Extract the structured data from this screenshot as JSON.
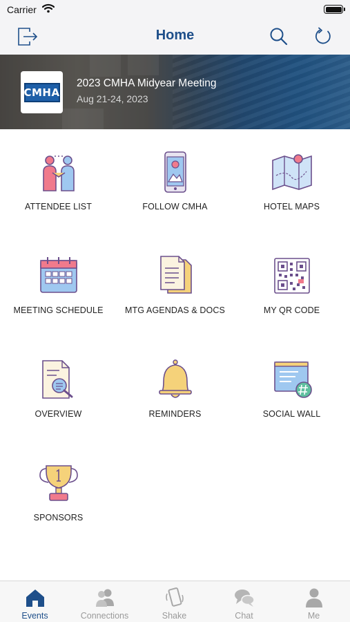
{
  "status_bar": {
    "carrier": "Carrier"
  },
  "nav": {
    "title": "Home",
    "left_icon": "logout-icon",
    "right_icons": [
      "search-icon",
      "refresh-icon"
    ]
  },
  "banner": {
    "event_title": "2023 CMHA Midyear Meeting",
    "event_dates": "Aug 21-24, 2023",
    "logo_text": "CMHA"
  },
  "tiles": [
    {
      "label": "ATTENDEE LIST",
      "icon": "handshake-icon"
    },
    {
      "label": "FOLLOW CMHA",
      "icon": "phone-profile-icon"
    },
    {
      "label": "HOTEL MAPS",
      "icon": "map-pin-icon"
    },
    {
      "label": "MEETING SCHEDULE",
      "icon": "calendar-icon"
    },
    {
      "label": "MTG AGENDAS & DOCS",
      "icon": "documents-icon"
    },
    {
      "label": "MY QR CODE",
      "icon": "qr-code-icon"
    },
    {
      "label": "OVERVIEW",
      "icon": "document-search-icon"
    },
    {
      "label": "REMINDERS",
      "icon": "bell-icon"
    },
    {
      "label": "SOCIAL WALL",
      "icon": "hashtag-board-icon"
    },
    {
      "label": "SPONSORS",
      "icon": "trophy-icon"
    }
  ],
  "tab_bar": {
    "active": "Events",
    "tabs": [
      {
        "label": "Events",
        "icon": "house-icon"
      },
      {
        "label": "Connections",
        "icon": "people-icon"
      },
      {
        "label": "Shake",
        "icon": "phone-shake-icon"
      },
      {
        "label": "Chat",
        "icon": "chat-bubbles-icon"
      },
      {
        "label": "Me",
        "icon": "person-icon"
      }
    ]
  },
  "colors": {
    "accent": "#1e4f8a",
    "icon_outline": "#6b4f8c",
    "icon_fill_blue": "#9fc8f0",
    "icon_fill_pink": "#f07a8c",
    "icon_fill_yellow": "#f5d27a",
    "tab_inactive": "#9a9a9a"
  }
}
